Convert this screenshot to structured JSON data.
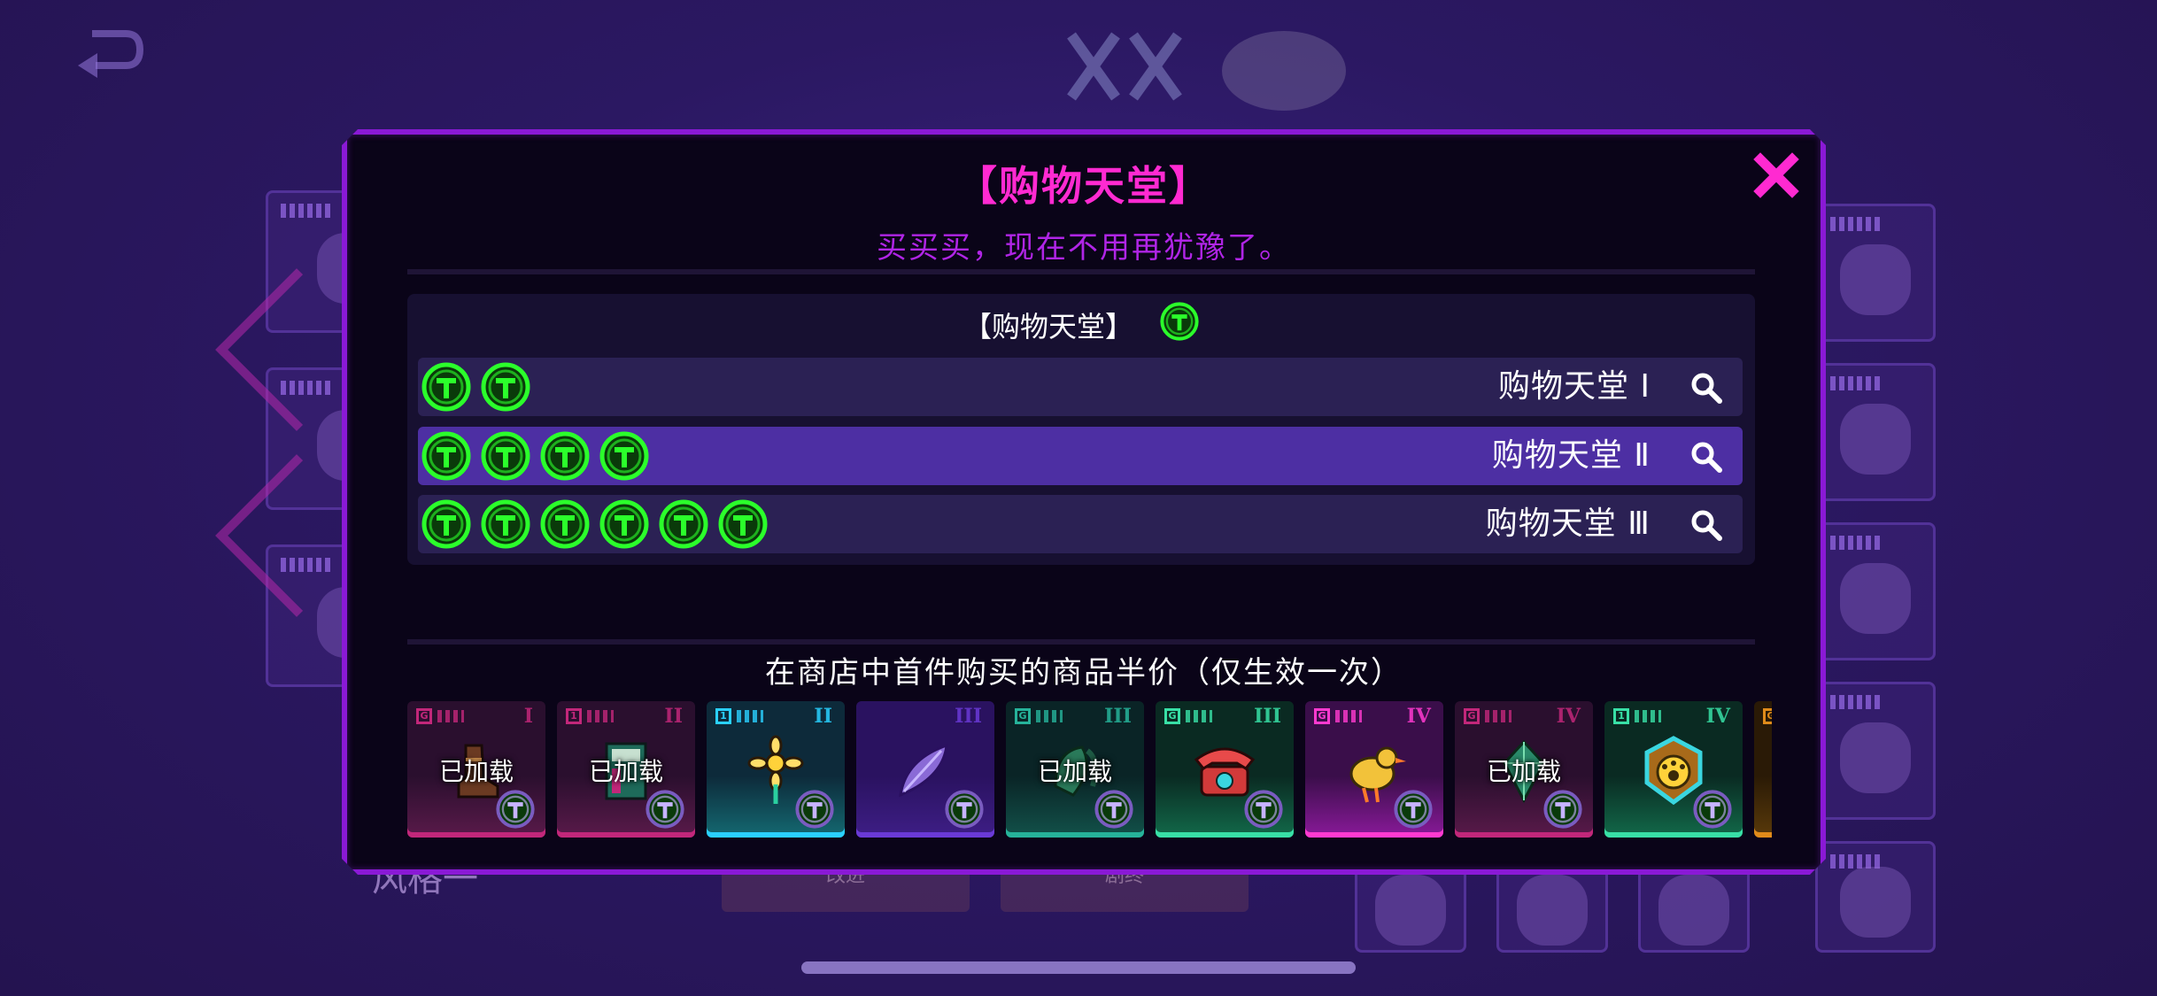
{
  "background": {
    "style_label": "风格一",
    "btn_left": "改进",
    "btn_right": "剧终"
  },
  "modal": {
    "title": "【购物天堂】",
    "subtitle": "买买买，现在不用再犹豫了。",
    "tiers_header": "【购物天堂】",
    "tiers": [
      {
        "label": "购物天堂 Ⅰ",
        "token_count": 2,
        "active": false
      },
      {
        "label": "购物天堂 Ⅱ",
        "token_count": 4,
        "active": true
      },
      {
        "label": "购物天堂 Ⅲ",
        "token_count": 6,
        "active": false
      }
    ],
    "effect": "在商店中首件购买的商品半价（仅生效一次）"
  },
  "items": [
    {
      "tier": "I",
      "tag": "G",
      "tag_color": "#c2277a",
      "loaded": "已加载",
      "theme": "pink",
      "art": "boot-icon"
    },
    {
      "tier": "II",
      "tag": "1",
      "tag_color": "#c2277a",
      "loaded": "已加载",
      "theme": "pink",
      "art": "book-icon"
    },
    {
      "tier": "II",
      "tag": "1",
      "tag_color": "#2ad0ff",
      "loaded": "",
      "theme": "cyan",
      "art": "flower-icon"
    },
    {
      "tier": "III",
      "tag": "",
      "tag_color": "#7a5cc0",
      "loaded": "",
      "theme": "purple",
      "art": "feather-icon"
    },
    {
      "tier": "III",
      "tag": "G",
      "tag_color": "#26b39a",
      "loaded": "已加载",
      "theme": "teal",
      "art": "leaf-icon"
    },
    {
      "tier": "III",
      "tag": "G",
      "tag_color": "#38e0a6",
      "loaded": "",
      "theme": "green",
      "art": "telephone-icon"
    },
    {
      "tier": "IV",
      "tag": "G",
      "tag_color": "#ff3ad0",
      "loaded": "",
      "theme": "magenta",
      "art": "bird-icon"
    },
    {
      "tier": "IV",
      "tag": "G",
      "tag_color": "#c2277a",
      "loaded": "已加载",
      "theme": "pink",
      "art": "gem-icon"
    },
    {
      "tier": "IV",
      "tag": "1",
      "tag_color": "#38e0a6",
      "loaded": "",
      "theme": "green",
      "art": "paw-badge-icon"
    },
    {
      "tier": "",
      "tag": "G",
      "tag_color": "#e08b1a",
      "loaded": "",
      "theme": "orange",
      "art": ""
    }
  ],
  "colors": {
    "accent_magenta": "#ff2ad1",
    "frame_purple": "#8a19d6",
    "token_green": "#2bff2b",
    "active_row": "#4d2fa3"
  }
}
